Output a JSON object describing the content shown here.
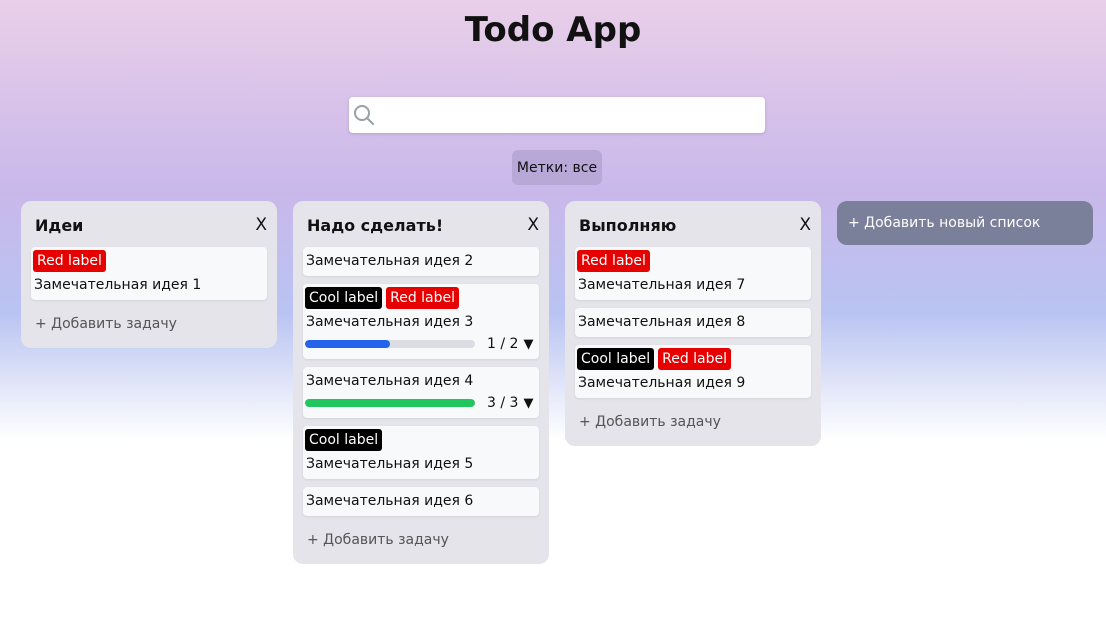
{
  "app": {
    "title": "Todo App"
  },
  "search": {
    "value": "",
    "placeholder": ""
  },
  "filter": {
    "label": "Метки: все"
  },
  "colors": {
    "cool_label": "#000000",
    "red_label": "#e60000",
    "progress_blue": "#2563eb",
    "progress_green": "#22c55e"
  },
  "columns": [
    {
      "title": "Идеи",
      "close": "X",
      "cards": [
        {
          "tags": [
            "Red label"
          ],
          "text": "Замечательная идея 1"
        }
      ],
      "add_task": "+ Добавить задачу"
    },
    {
      "title": "Надо сделать!",
      "close": "X",
      "cards": [
        {
          "text": "Замечательная идея 2"
        },
        {
          "tags": [
            "Cool label",
            "Red label"
          ],
          "text": "Замечательная идея 3",
          "progress": {
            "text": "1 / 2",
            "fraction": 0.5
          }
        },
        {
          "text": "Замечательная идея 4",
          "progress": {
            "text": "3 / 3",
            "fraction": 1
          }
        },
        {
          "tags": [
            "Cool label"
          ],
          "text": "Замечательная идея 5"
        },
        {
          "text": "Замечательная идея 6"
        }
      ],
      "add_task": "+ Добавить задачу"
    },
    {
      "title": "Выполняю",
      "close": "X",
      "cards": [
        {
          "tags": [
            "Red label"
          ],
          "text": "Замечательная идея 7"
        },
        {
          "text": "Замечательная идея 8"
        },
        {
          "tags": [
            "Cool label",
            "Red label"
          ],
          "text": "Замечательная идея 9"
        }
      ],
      "add_task": "+ Добавить задачу"
    }
  ],
  "add_list": {
    "label": "+ Добавить новый список"
  }
}
